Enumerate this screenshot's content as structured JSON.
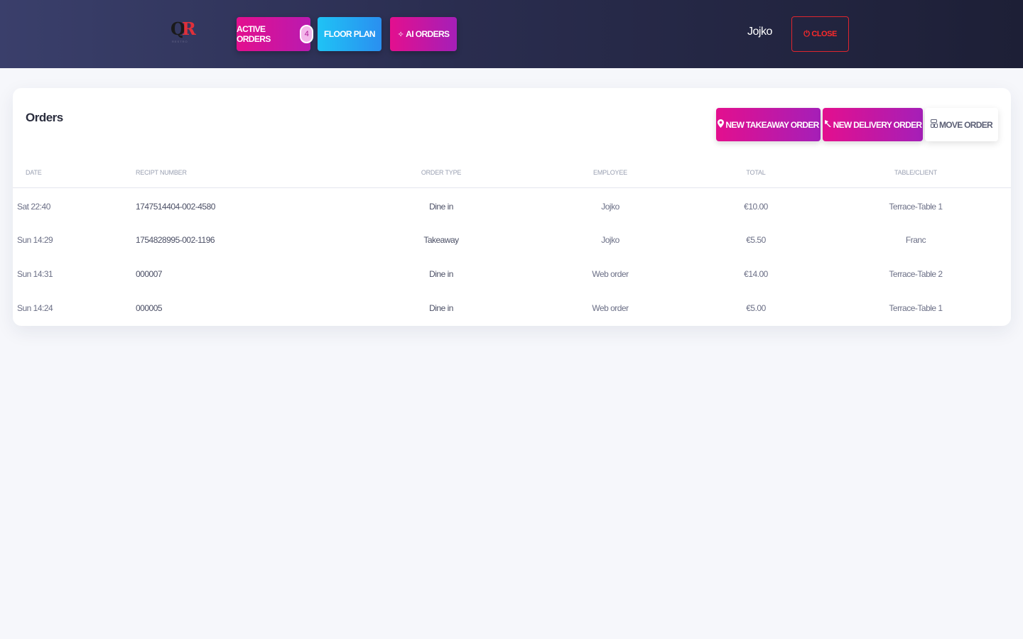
{
  "header": {
    "logo_text": "QR",
    "logo_subtext": "RESTRO",
    "nav": {
      "active_orders_label": "ACTIVE ORDERS",
      "active_orders_count": "4",
      "floor_plan_label": "FLOOR PLAN",
      "ai_orders_label": "AI ORDERS"
    },
    "user_name": "Jojko",
    "close_label": "CLOSE"
  },
  "orders": {
    "title": "Orders",
    "actions": {
      "new_takeaway_label": "NEW TAKEAWAY ORDER",
      "new_delivery_label": "NEW DELIVERY ORDER",
      "move_order_label": "MOVE ORDER"
    },
    "columns": {
      "date": "DATE",
      "receipt": "RECIPT NUMBER",
      "order_type": "ORDER TYPE",
      "employee": "EMPLOYEE",
      "total": "TOTAL",
      "table_client": "TABLE/CLIENT"
    },
    "rows": [
      {
        "date": "Sat 22:40",
        "receipt": "1747514404-002-4580",
        "order_type": "Dine in",
        "employee": "Jojko",
        "total": "€10.00",
        "table_client": "Terrace-Table 1"
      },
      {
        "date": "Sun 14:29",
        "receipt": "1754828995-002-1196",
        "order_type": "Takeaway",
        "employee": "Jojko",
        "total": "€5.50",
        "table_client": "Franc"
      },
      {
        "date": "Sun 14:31",
        "receipt": "000007",
        "order_type": "Dine in",
        "employee": "Web order",
        "total": "€14.00",
        "table_client": "Terrace-Table 2"
      },
      {
        "date": "Sun 14:24",
        "receipt": "000005",
        "order_type": "Dine in",
        "employee": "Web order",
        "total": "€5.00",
        "table_client": "Terrace-Table 1"
      }
    ]
  },
  "icons": {
    "sparkle": "sparkle-icon",
    "power": "power-icon",
    "map_pin": "map-pin-icon",
    "delivery": "delivery-icon",
    "move": "move-icon"
  },
  "colors": {
    "brand_pink": "#e30f8e",
    "brand_purple": "#a51fb8",
    "floor_blue": "#1fc3f5",
    "close_red": "#e0252e",
    "header_dark": "#2a2d4f"
  }
}
